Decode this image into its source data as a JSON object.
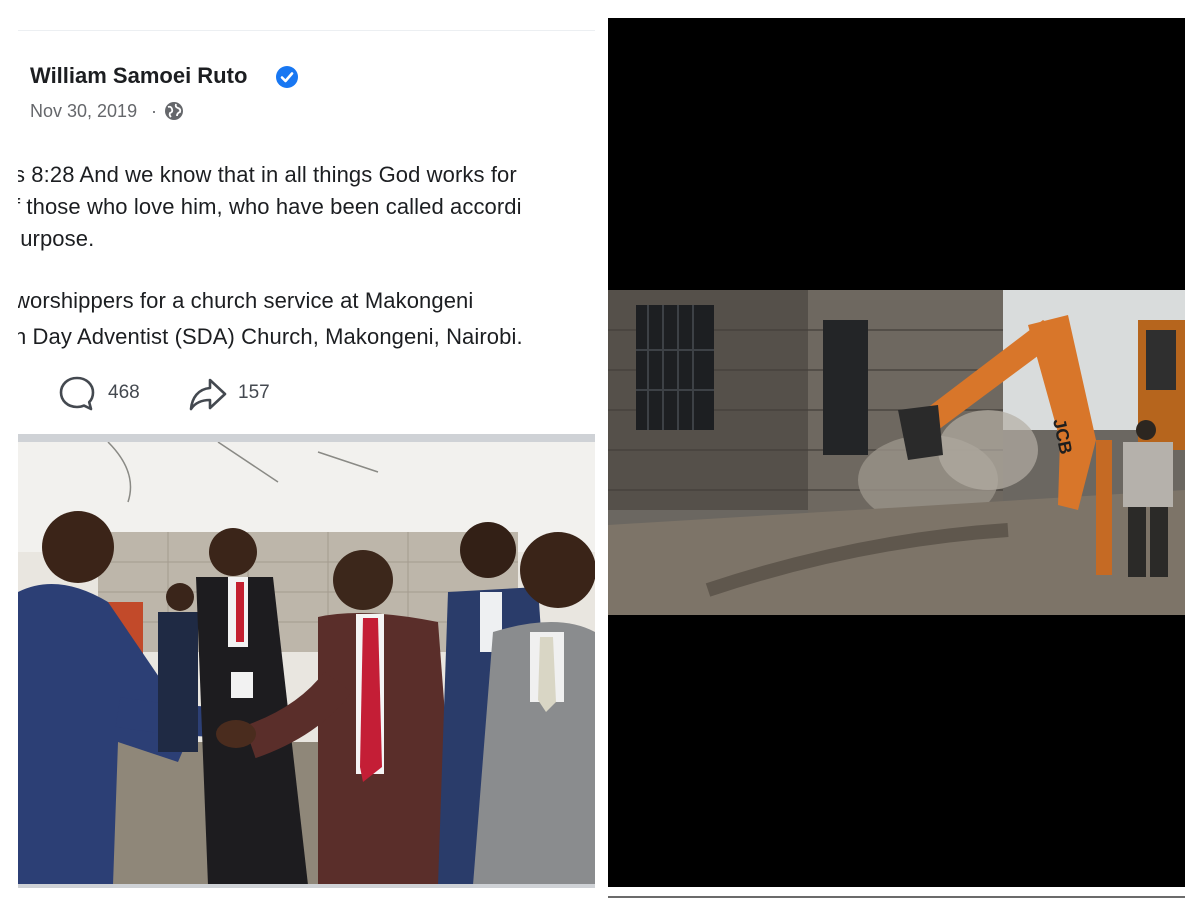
{
  "post": {
    "author": "William Samoei Ruto",
    "verified": true,
    "date": "Nov 30, 2019",
    "date_separator": "·",
    "audience_icon": "globe-icon",
    "body_lines": [
      "s 8:28 And we know that in all things God works for",
      "f those who love him, who have been called accordi",
      "ıurpose.",
      "worshippers for a church service at Makongeni",
      "h Day Adventist (SDA) Church, Makongeni, Nairobi."
    ],
    "comments": "468",
    "shares": "157",
    "photo_alt": ""
  },
  "video": {
    "frame_alt": "",
    "machine_brand": "JCB"
  },
  "colors": {
    "verified_blue": "#1877f2",
    "text_primary": "#1c1e21",
    "text_secondary": "#65676b",
    "excavator_orange": "#d8762a"
  }
}
